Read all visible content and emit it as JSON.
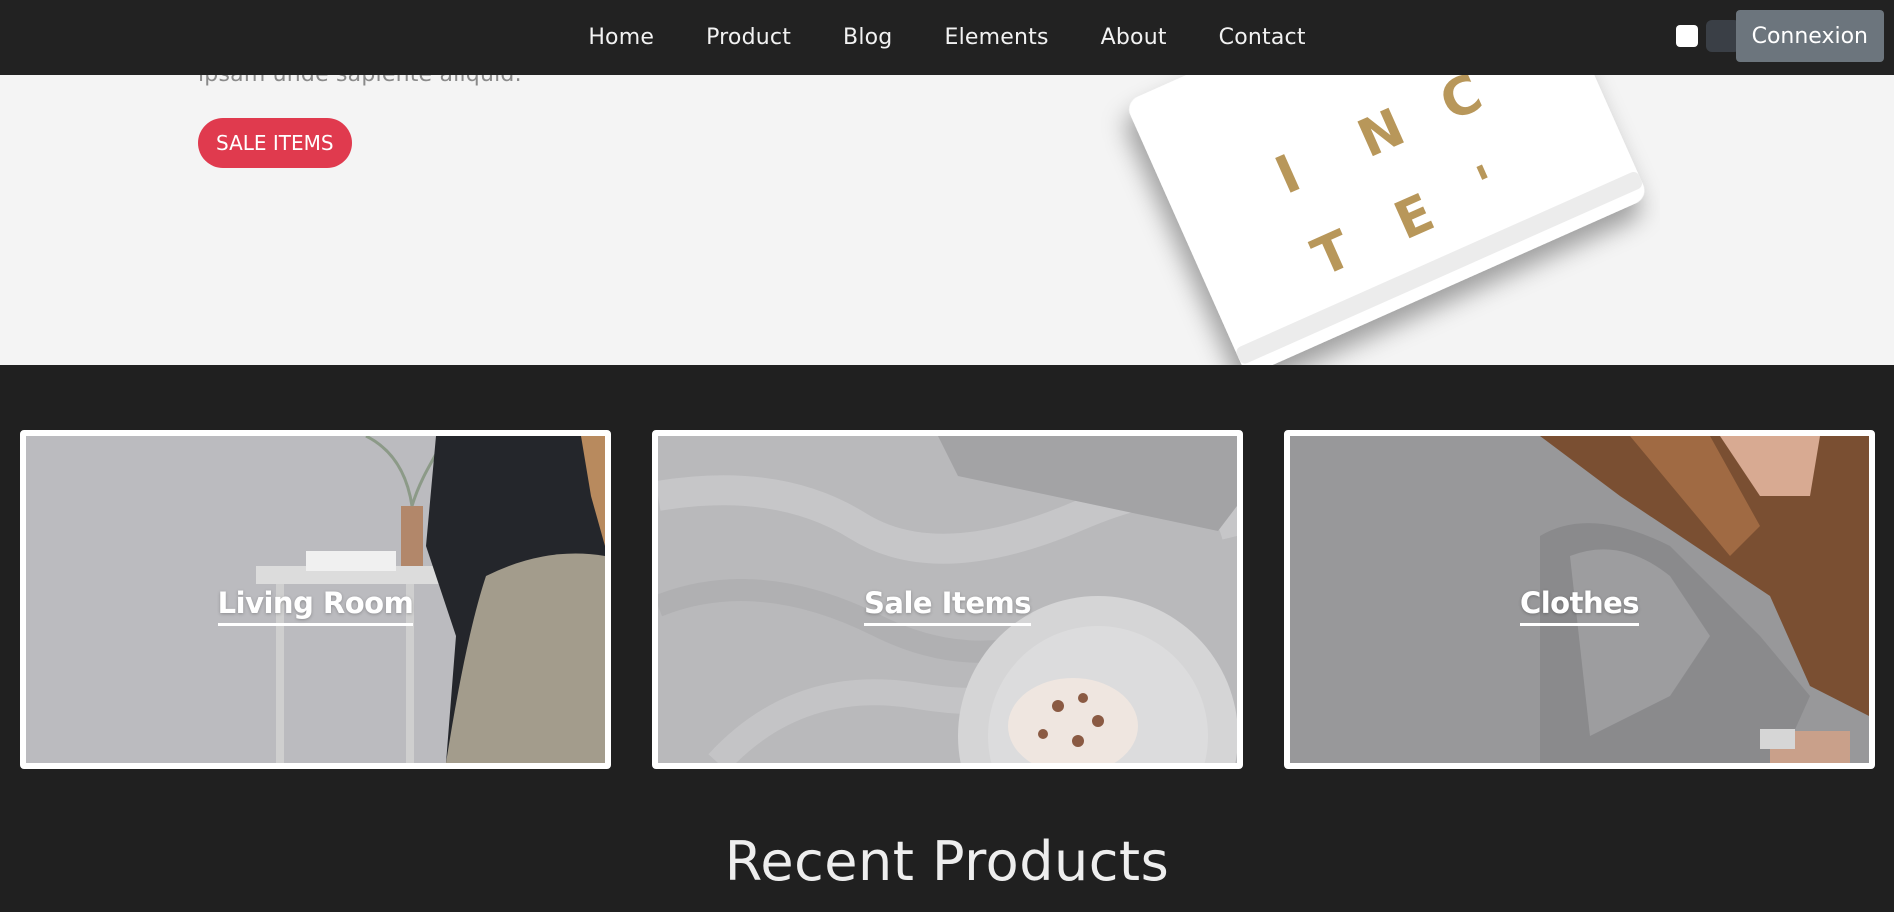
{
  "nav": {
    "links": [
      "Home",
      "Product",
      "Blog",
      "Elements",
      "About",
      "Contact"
    ],
    "login_label": "Connexion",
    "theme_swatches": [
      {
        "name": "light",
        "color": "#ffffff"
      },
      {
        "name": "dark",
        "color": "#3a3f46"
      }
    ]
  },
  "hero": {
    "text": "ipsam unde sapiente aliquid.",
    "sale_button_label": "SALE ITEMS",
    "art_letters": [
      "I",
      "N",
      "C",
      "T",
      "E",
      "'"
    ]
  },
  "categories": [
    {
      "label": "Living Room",
      "icon": "living-room-photo"
    },
    {
      "label": "Sale Items",
      "icon": "bedsheet-photo"
    },
    {
      "label": "Clothes",
      "icon": "woman-photo"
    }
  ],
  "recent": {
    "title": "Recent Products"
  },
  "colors": {
    "navbar": "#222222",
    "page_bg": "#202020",
    "hero_bg": "#f4f4f4",
    "sale_accent": "#e03a4e",
    "login_button": "#6c757d"
  }
}
